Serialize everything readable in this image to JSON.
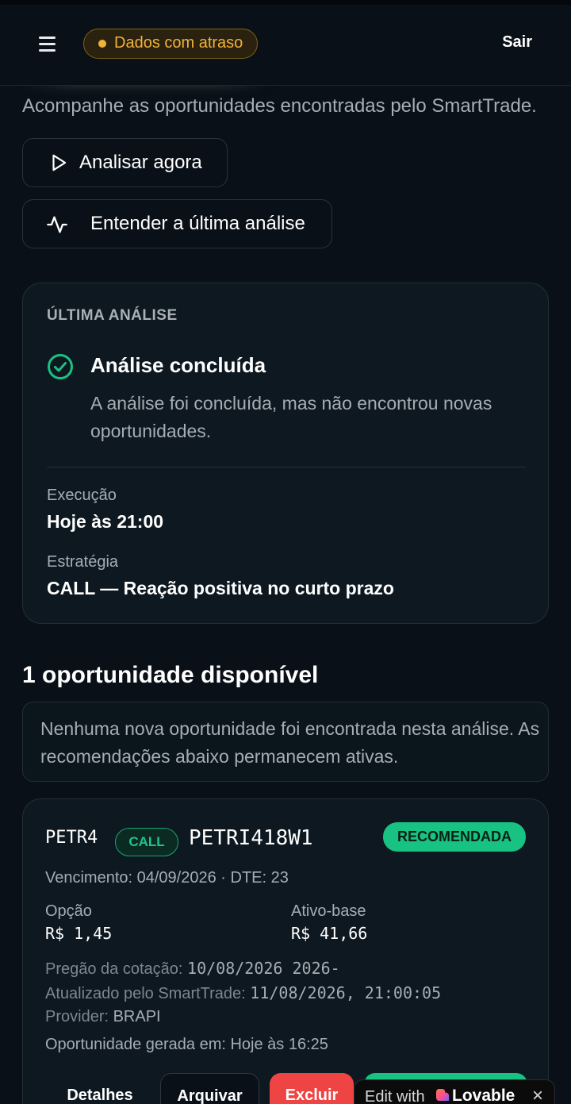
{
  "header": {
    "delay_badge": "Dados com atraso",
    "logout": "Sair"
  },
  "page": {
    "subtitle": "Acompanhe as oportunidades encontradas pelo SmartTrade."
  },
  "actions": {
    "analyze_now": "Analisar agora",
    "understand_last": "Entender a última análise"
  },
  "last_analysis": {
    "section_label": "ÚLTIMA ANÁLISE",
    "status_title": "Análise concluída",
    "status_desc": "A análise foi concluída, mas não encontrou novas oportunidades.",
    "execution_label": "Execução",
    "execution_value": "Hoje às 21:00",
    "strategy_label": "Estratégia",
    "strategy_value": "CALL — Reação positiva no curto prazo"
  },
  "opportunities": {
    "heading": "1 oportunidade disponível",
    "notice": "Nenhuma nova oportunidade foi encontrada nesta análise. As recomendações abaixo permanecem ativas.",
    "items": [
      {
        "ticker": "PETR4",
        "type": "CALL",
        "option_code": "PETRI418W1",
        "status": "RECOMENDADA",
        "expiry_line": "Vencimento: 04/09/2026 · DTE: 23",
        "option_label": "Opção",
        "option_price": "R$ 1,45",
        "underlying_label": "Ativo-base",
        "underlying_price": "R$ 41,66",
        "quote_session_label": "Pregão da cotação:",
        "quote_session_value": "10/08/2026 2026-",
        "updated_label": "Atualizado pelo SmartTrade:",
        "updated_value": "11/08/2026, 21:00:05",
        "provider_label": "Provider:",
        "provider_value": "BRAPI",
        "generated_line": "Oportunidade gerada em: Hoje às 16:25",
        "btn_details": "Detalhes",
        "btn_archive": "Arquivar",
        "btn_delete": "Excluir"
      }
    ]
  },
  "lovable": {
    "edit_with": "Edit with",
    "brand": "Lovable",
    "close": "×"
  },
  "colors": {
    "background": "#091017",
    "card": "#0d1820",
    "accent_green": "#18c283",
    "warning": "#f1b23a",
    "danger": "#ef4444"
  }
}
